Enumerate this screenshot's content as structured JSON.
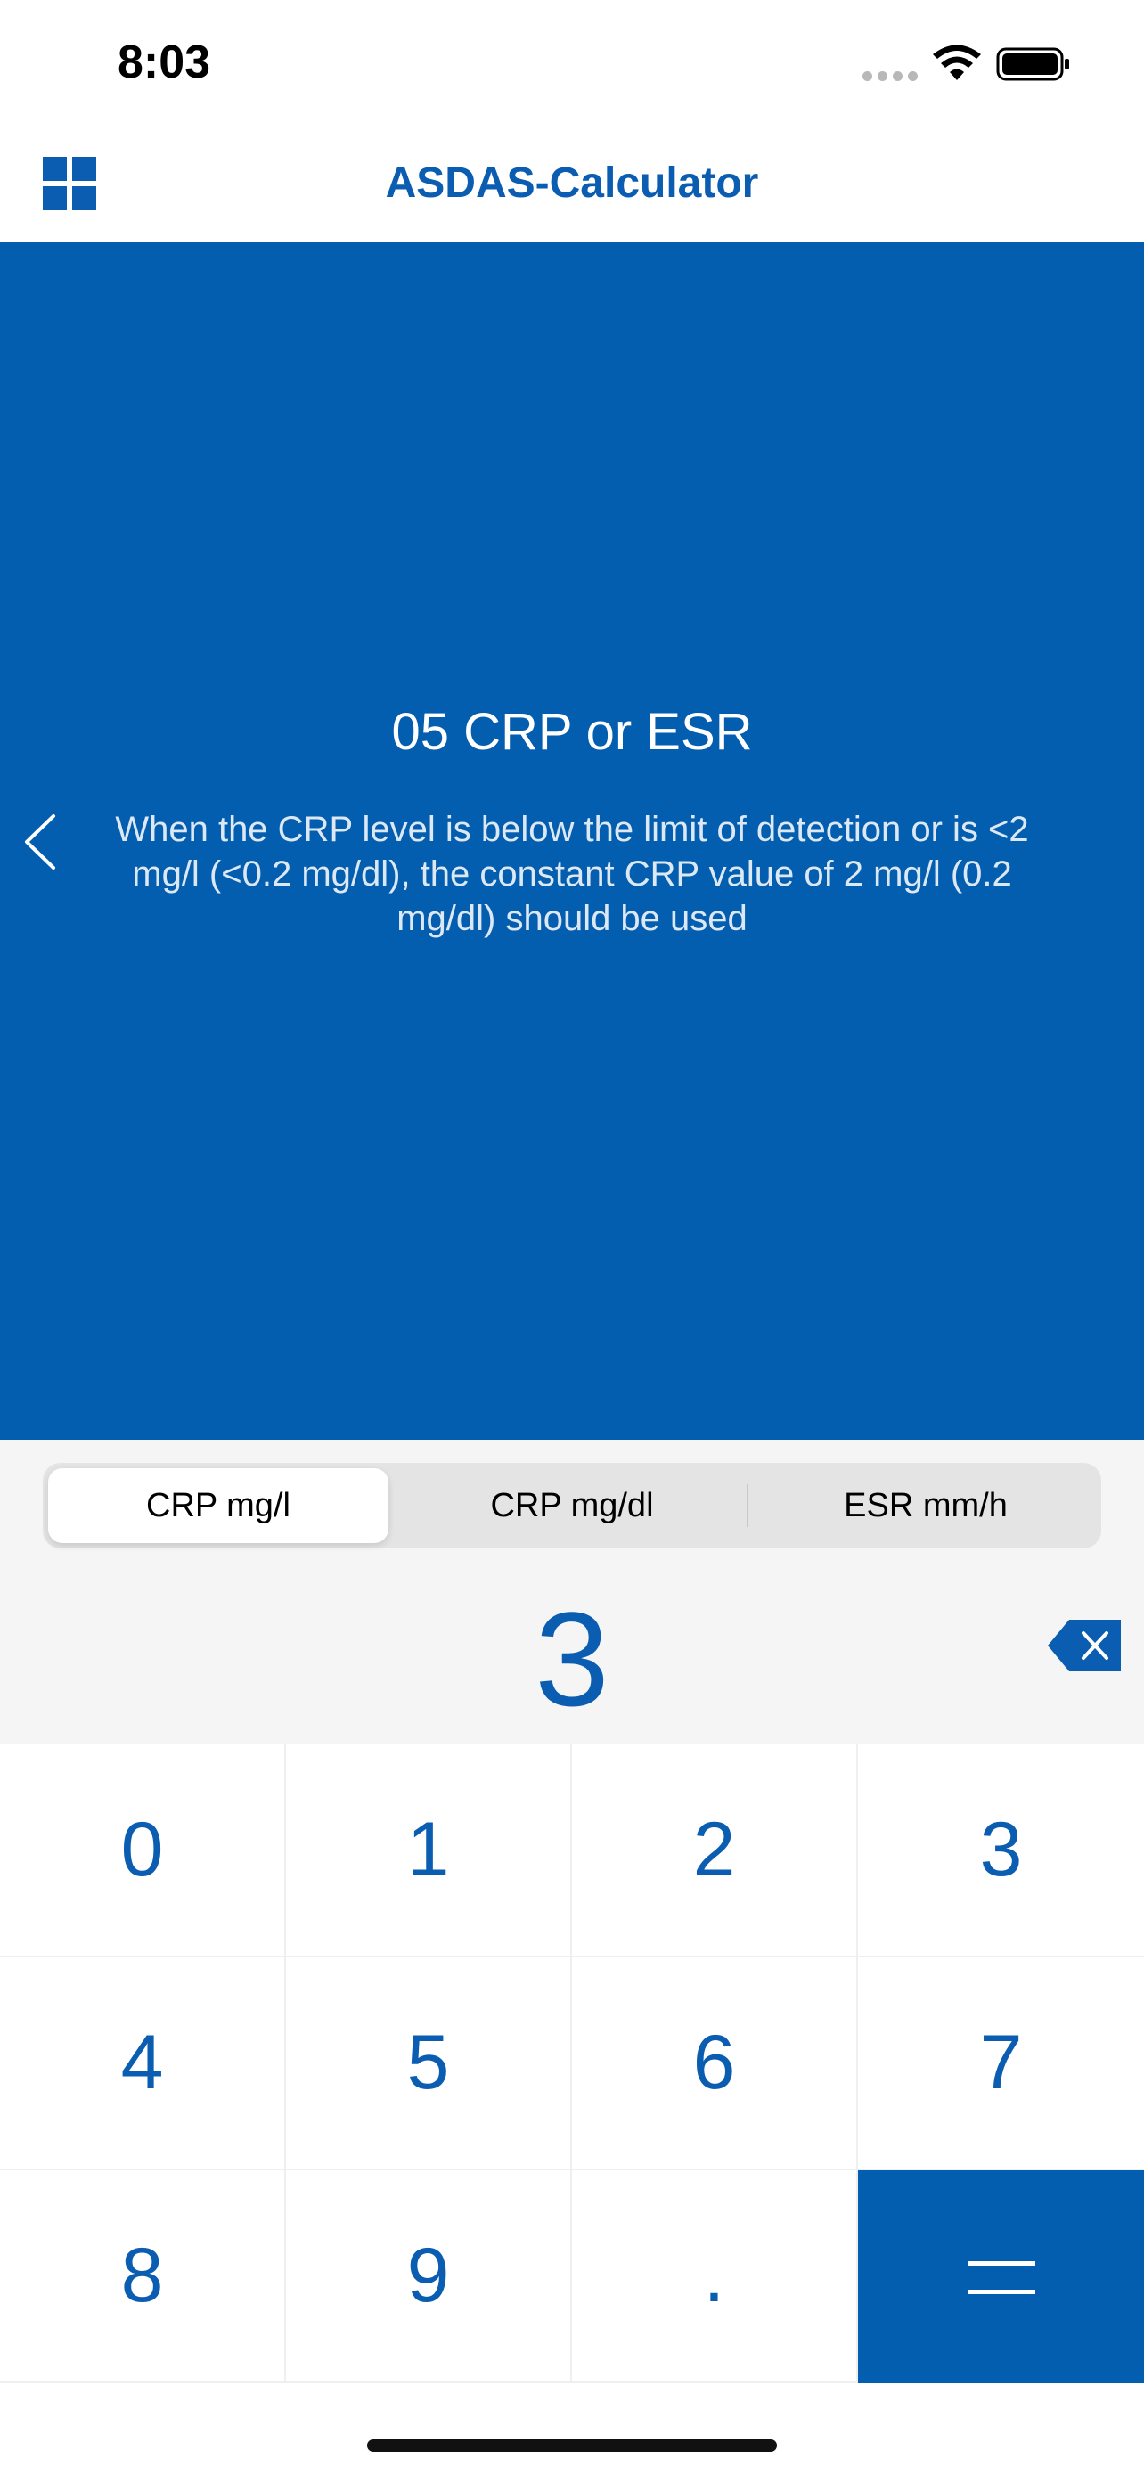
{
  "status_bar": {
    "time": "8:03"
  },
  "nav": {
    "title": "ASDAS-Calculator",
    "menu_icon": "grid-icon"
  },
  "info": {
    "title": "05 CRP or ESR",
    "description": "When the CRP level is below the limit of detection or is <2 mg/l (<0.2 mg/dl), the constant CRP value of 2 mg/l (0.2 mg/dl) should be used",
    "back_icon": "chevron-left-icon"
  },
  "segments": {
    "items": [
      "CRP mg/l",
      "CRP mg/dl",
      "ESR mm/h"
    ],
    "selected": "CRP mg/l"
  },
  "display": {
    "value": "3",
    "backspace_icon": "backspace-icon"
  },
  "keypad": {
    "keys": [
      "0",
      "1",
      "2",
      "3",
      "4",
      "5",
      "6",
      "7",
      "8",
      "9",
      "."
    ],
    "equals_icon": "equals-icon"
  },
  "colors": {
    "brand_blue": "#035eb0",
    "text_blue": "#0a5db0"
  }
}
